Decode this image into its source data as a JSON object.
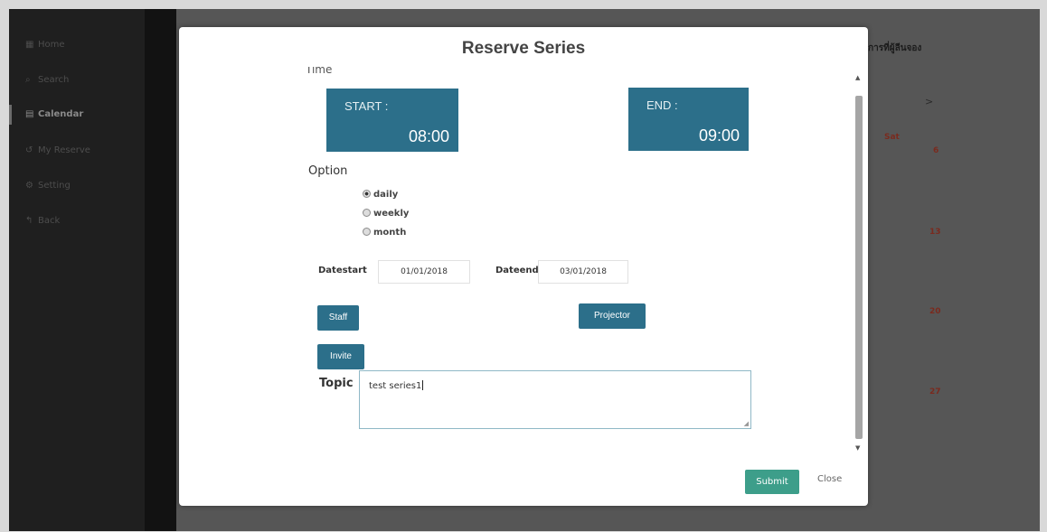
{
  "sidebar": {
    "items": [
      {
        "label": "Home",
        "icon": "grid-icon",
        "glyph": "▦"
      },
      {
        "label": "Search",
        "icon": "search-icon",
        "glyph": "⌕"
      },
      {
        "label": "Calendar",
        "icon": "calendar-icon",
        "glyph": "▤"
      },
      {
        "label": "My Reserve",
        "icon": "history-icon",
        "glyph": "↺"
      },
      {
        "label": "Setting",
        "icon": "gear-icon",
        "glyph": "⚙"
      },
      {
        "label": "Back",
        "icon": "back-icon",
        "glyph": "↰"
      }
    ],
    "active_index": 2
  },
  "background": {
    "heading": "าดการที่ผู้ลีนจอง",
    "next_arrow": ">",
    "sat_label": "Sat",
    "day_numbers": [
      "6",
      "13",
      "20",
      "27"
    ]
  },
  "modal": {
    "title": "Reserve Series",
    "time_label": "Time",
    "start": {
      "caption": "START :",
      "value": "08:00"
    },
    "end": {
      "caption": "END :",
      "value": "09:00"
    },
    "option_label": "Option",
    "options": [
      {
        "label": "daily",
        "selected": true
      },
      {
        "label": "weekly",
        "selected": false
      },
      {
        "label": "month",
        "selected": false
      }
    ],
    "datestart_label": "Datestart",
    "datestart_value": "01/01/2018",
    "dateend_label": "Dateend",
    "dateend_value": "03/01/2018",
    "staff_button": "Staff",
    "projector_button": "Projector",
    "invite_button": "Invite",
    "topic_label": "Topic",
    "topic_value": "test series1",
    "submit_button": "Submit",
    "close_button": "Close"
  },
  "colors": {
    "accent": "#2c6f8a",
    "submit": "#3d9e8a"
  }
}
